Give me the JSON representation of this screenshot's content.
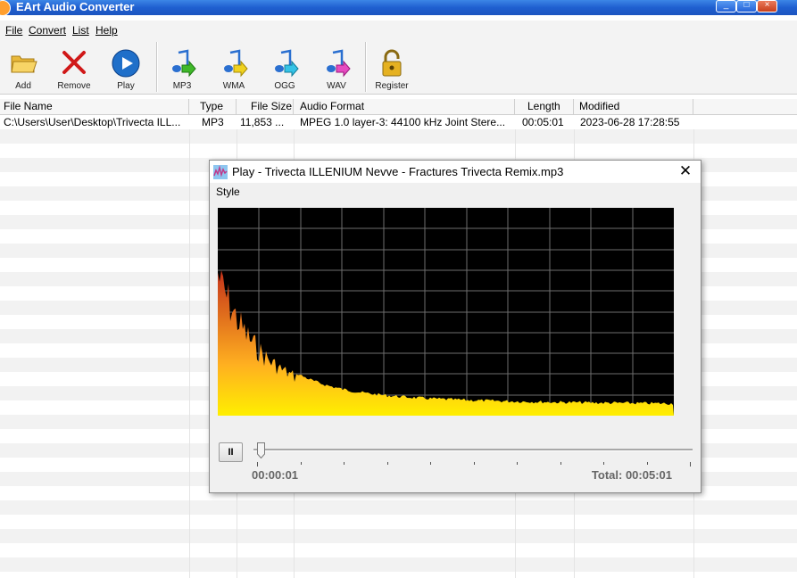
{
  "window": {
    "title": "EArt Audio Converter"
  },
  "menu": [
    {
      "label": "File"
    },
    {
      "label": "Convert"
    },
    {
      "label": "List"
    },
    {
      "label": "Help"
    }
  ],
  "toolbar": {
    "add": "Add",
    "remove": "Remove",
    "play": "Play",
    "mp3": "MP3",
    "wma": "WMA",
    "ogg": "OGG",
    "wav": "WAV",
    "register": "Register"
  },
  "table": {
    "columns": [
      "File Name",
      "Type",
      "File Size",
      "Audio Format",
      "Length",
      "Modified"
    ],
    "rows": [
      [
        "C:\\Users\\User\\Desktop\\Trivecta ILL...",
        "MP3",
        "11,853 ...",
        "MPEG 1.0 layer-3: 44100 kHz Joint Stere...",
        "00:05:01",
        "2023-06-28 17:28:55"
      ]
    ]
  },
  "player": {
    "title": "Play - Trivecta ILLENIUM Nevve - Fractures Trivecta Remix.mp3",
    "menu_style": "Style",
    "pause_label": "II",
    "current_time": "00:00:01",
    "total_time": "Total: 00:05:01",
    "progress": 0.003,
    "colors": {
      "background": "#000000",
      "grid": "#6e6e6e",
      "low": "#ffef00",
      "high": "#c4321a"
    }
  }
}
